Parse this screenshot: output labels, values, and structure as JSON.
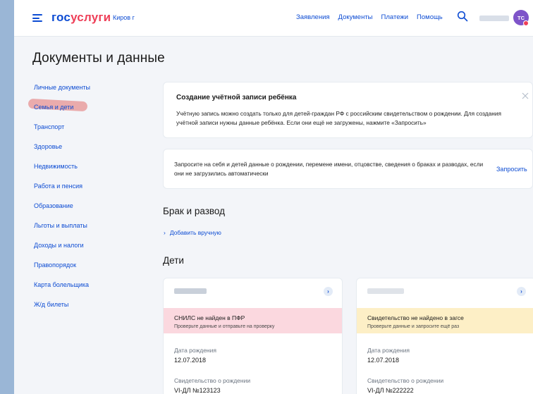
{
  "header": {
    "logo_part1": "гос",
    "logo_part2": "услуги",
    "city": "Киров г",
    "nav": [
      "Заявления",
      "Документы",
      "Платежи",
      "Помощь"
    ],
    "avatar_initials": "ТС"
  },
  "page": {
    "title": "Документы и данные"
  },
  "sidebar": {
    "items": [
      {
        "label": "Личные документы"
      },
      {
        "label": "Семья и дети"
      },
      {
        "label": "Транспорт"
      },
      {
        "label": "Здоровье"
      },
      {
        "label": "Недвижимость"
      },
      {
        "label": "Работа и пенсия"
      },
      {
        "label": "Образование"
      },
      {
        "label": "Льготы и выплаты"
      },
      {
        "label": "Доходы и налоги"
      },
      {
        "label": "Правопорядок"
      },
      {
        "label": "Карта болельщика"
      },
      {
        "label": "Ж/д билеты"
      }
    ],
    "active_index": 1
  },
  "info_card": {
    "title": "Создание учётной записи ребёнка",
    "text": "Учётную запись можно создать только для детей-граждан РФ с российским свидетельством о рождении. Для создания учётной записи нужны данные ребёнка. Если они ещё не загружены, нажмите «Запросить»"
  },
  "request_card": {
    "text": "Запросите на себя и детей данные о рождении, перемене имени, отцовстве, сведения о браках и разводах, если они не загрузились автоматически",
    "link": "Запросить"
  },
  "marriage": {
    "title": "Брак и развод",
    "add_link": "Добавить вручную"
  },
  "children": {
    "title": "Дети",
    "cards": [
      {
        "warning_title": "СНИЛС не найден в ПФР",
        "warning_sub": "Проверьте данные и отправьте на проверку",
        "warning_bg": "#fbd8df",
        "birth_label": "Дата рождения",
        "birth_value": "12.07.2018",
        "cert_label": "Свидетельство о рождении",
        "cert_value": "VI-ДЛ №123123"
      },
      {
        "warning_title": "Свидетельство не найдено в загсе",
        "warning_sub": "Проверьте данные и запросите ещё раз",
        "warning_bg": "#fdefc6",
        "birth_label": "Дата рождения",
        "birth_value": "12.07.2018",
        "cert_label": "Свидетельство о рождении",
        "cert_value": "VI-ДЛ №222222"
      }
    ]
  },
  "colors": {
    "brand_blue": "#0d4cd3",
    "brand_red": "#ee3f58",
    "background": "#f3f5f9"
  }
}
